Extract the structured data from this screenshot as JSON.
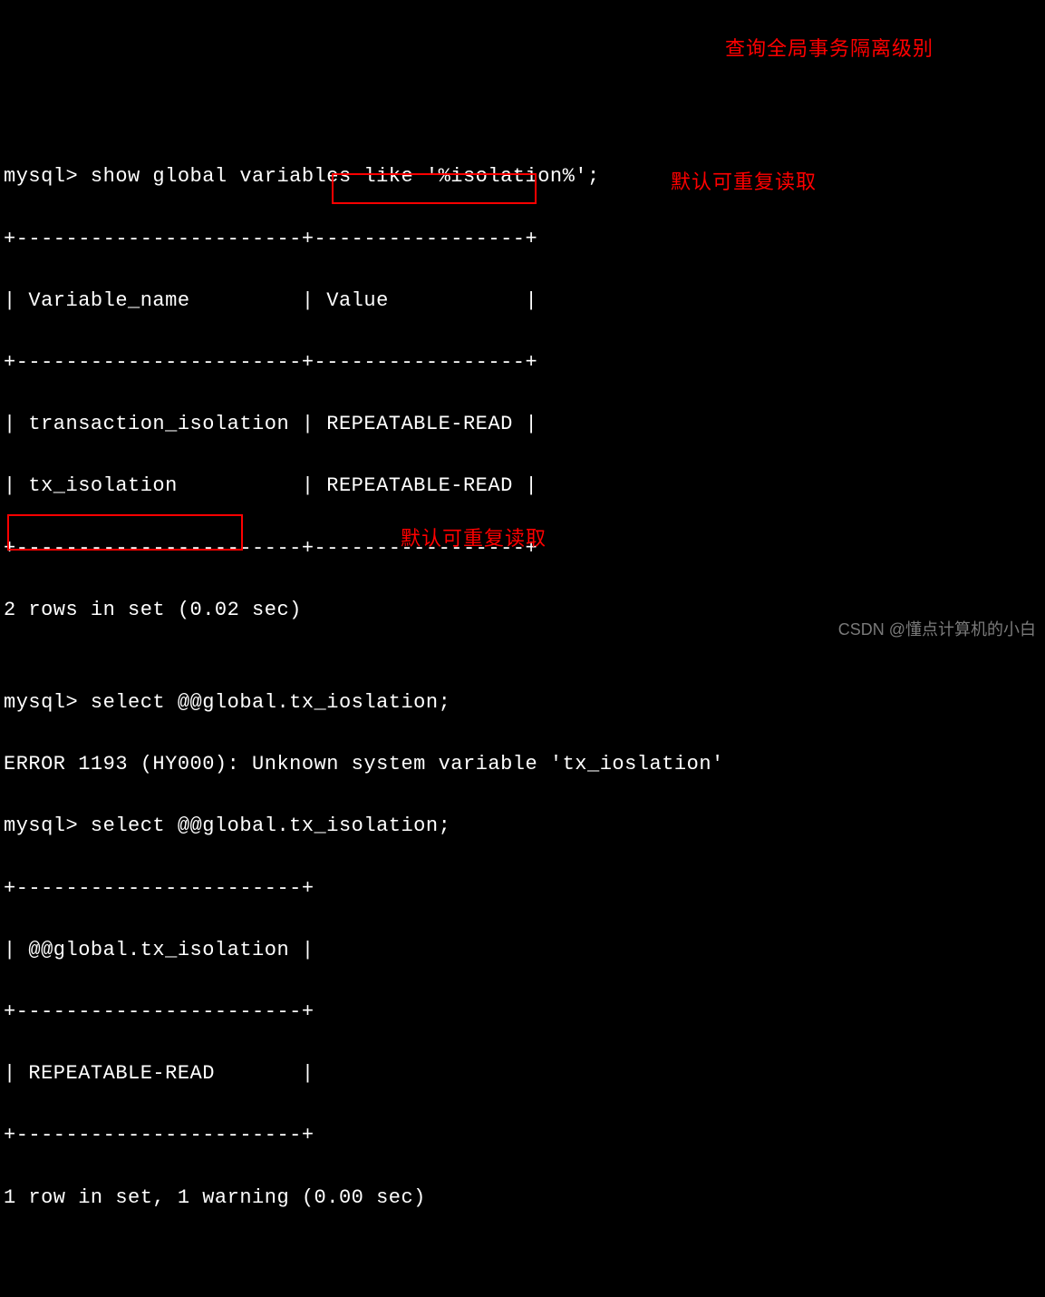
{
  "terminal": {
    "line1": "mysql> show global variables like '%isolation%';",
    "sep1": "+-----------------------+-----------------+",
    "header": "| Variable_name         | Value           |",
    "sep2": "+-----------------------+-----------------+",
    "row1": "| transaction_isolation | REPEATABLE-READ |",
    "row2": "| tx_isolation          | REPEATABLE-READ |",
    "sep3": "+-----------------------+-----------------+",
    "result1": "2 rows in set (0.02 sec)",
    "blank1": "",
    "line2": "mysql> select @@global.tx_ioslation;",
    "error": "ERROR 1193 (HY000): Unknown system variable 'tx_ioslation'",
    "line3": "mysql> select @@global.tx_isolation;",
    "sep4": "+-----------------------+",
    "header2": "| @@global.tx_isolation |",
    "sep5": "+-----------------------+",
    "row3": "| REPEATABLE-READ       |",
    "sep6": "+-----------------------+",
    "result2": "1 row in set, 1 warning (0.00 sec)"
  },
  "annotations": {
    "ann1": "查询全局事务隔离级别",
    "ann2": "默认可重复读取",
    "ann3": "默认可重复读取"
  },
  "watermark": "CSDN @懂点计算机的小白"
}
